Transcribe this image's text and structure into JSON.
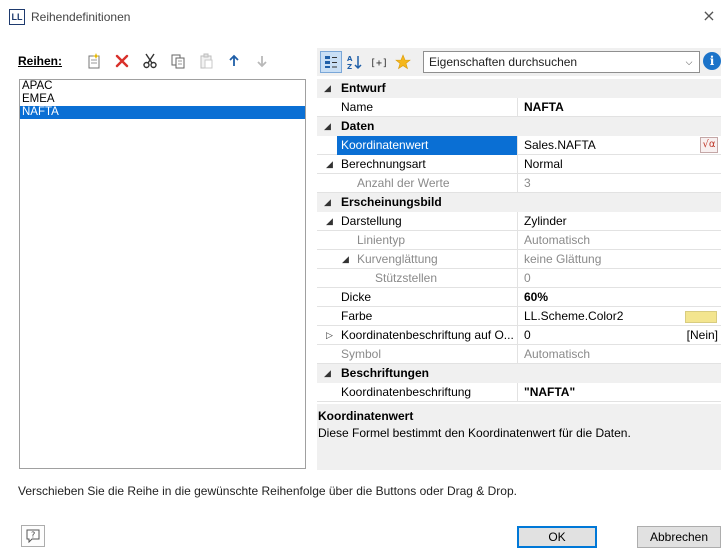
{
  "window": {
    "app_icon": "LL",
    "title": "Reihendefinitionen",
    "close_label": "×"
  },
  "left_panel": {
    "label": "Reihen:",
    "toolbar": [
      {
        "name": "new-series-icon",
        "enabled": true
      },
      {
        "name": "delete-icon",
        "enabled": true
      },
      {
        "name": "cut-icon",
        "enabled": true
      },
      {
        "name": "copy-icon",
        "enabled": true
      },
      {
        "name": "paste-icon",
        "enabled": false
      },
      {
        "name": "move-up-icon",
        "enabled": true
      },
      {
        "name": "move-down-icon",
        "enabled": false
      }
    ],
    "series": [
      "APAC",
      "EMEA",
      "NAFTA"
    ],
    "selected_index": 2
  },
  "right_panel": {
    "search_placeholder": "Eigenschaften durchsuchen",
    "info_label": "i",
    "properties": {
      "cat_entwurf": "Entwurf",
      "name_label": "Name",
      "name_value": "NAFTA",
      "cat_daten": "Daten",
      "koordinatenwert_label": "Koordinatenwert",
      "koordinatenwert_value": "Sales.NAFTA",
      "formula_symbol": "√α",
      "berechnungsart_label": "Berechnungsart",
      "berechnungsart_value": "Normal",
      "anzahl_label": "Anzahl der Werte",
      "anzahl_value": "3",
      "cat_erscheinungsbild": "Erscheinungsbild",
      "darstellung_label": "Darstellung",
      "darstellung_value": "Zylinder",
      "linientyp_label": "Linientyp",
      "linientyp_value": "Automatisch",
      "kurvenglaettung_label": "Kurvenglättung",
      "kurvenglaettung_value": "keine Glättung",
      "stuetzstellen_label": "Stützstellen",
      "stuetzstellen_value": "0",
      "dicke_label": "Dicke",
      "dicke_value": "60%",
      "farbe_label": "Farbe",
      "farbe_value": "LL.Scheme.Color2",
      "farbe_swatch": "#f3e58f",
      "koordbeschr_o_label": "Koordinatenbeschriftung auf O...",
      "koordbeschr_o_value": "0",
      "koordbeschr_o_tag": "[Nein]",
      "symbol_label": "Symbol",
      "symbol_value": "Automatisch",
      "cat_beschriftungen": "Beschriftungen",
      "koordbeschr_label": "Koordinatenbeschriftung",
      "koordbeschr_value": "\"NAFTA\""
    },
    "description": {
      "title": "Koordinatenwert",
      "text": "Diese Formel bestimmt den Koordinatenwert für die Daten."
    }
  },
  "footer": {
    "hint": "Verschieben Sie die Reihe in die gewünschte Reihenfolge über die Buttons oder Drag & Drop.",
    "ok_label": "OK",
    "cancel_label": "Abbrechen"
  },
  "colors": {
    "selection": "#0a6fd4",
    "accent": "#1b73c9"
  }
}
